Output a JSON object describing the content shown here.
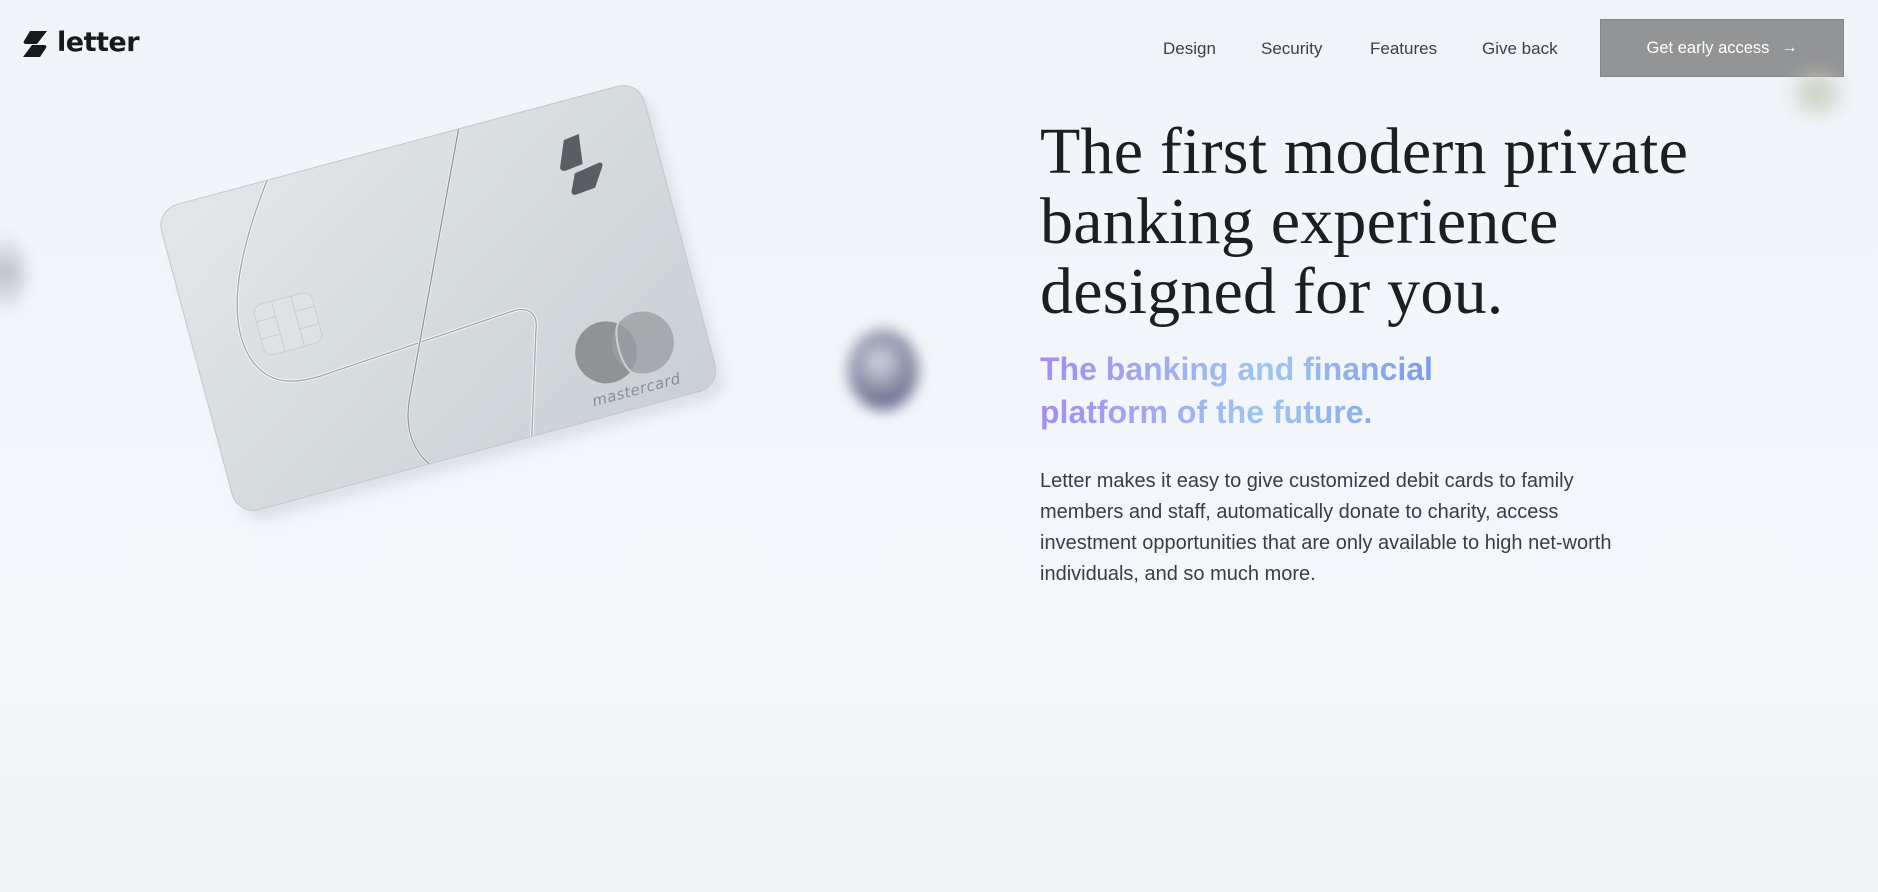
{
  "brand": {
    "name": "letter"
  },
  "nav": {
    "items": [
      {
        "label": "Design"
      },
      {
        "label": "Security"
      },
      {
        "label": "Features"
      },
      {
        "label": "Give back"
      }
    ],
    "cta_label": "Get early access",
    "cta_icon": "arrow-right-icon"
  },
  "hero": {
    "headline": "The first modern private banking experience designed for you.",
    "subhead": "The banking and financial platform of the future.",
    "body": "Letter makes it easy to give customized debit cards to family members and staff, automatically donate to charity, access investment opportunities that are only available to high net-worth individuals, and so much more."
  },
  "card": {
    "network_label": "mastercard"
  },
  "colors": {
    "cta_background": "#939496",
    "subhead_gradient_start": "#a68cf2",
    "subhead_gradient_mid": "#9ec6f0",
    "subhead_gradient_end": "#6f86ec",
    "headline": "#1c1e22"
  }
}
